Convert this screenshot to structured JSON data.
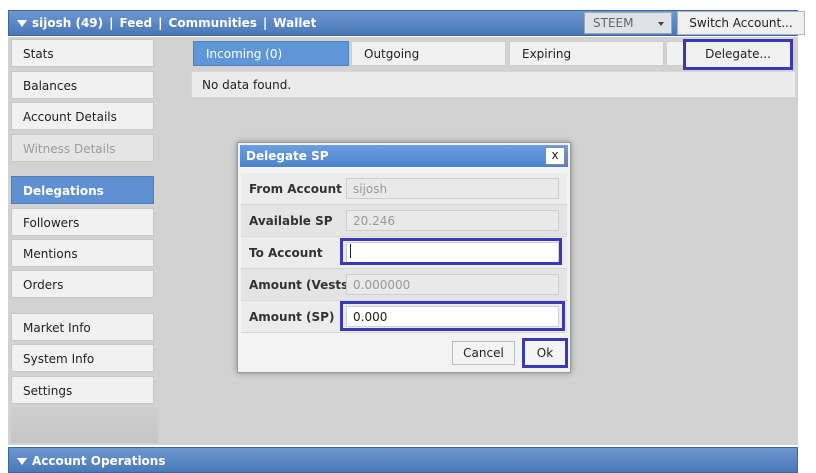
{
  "topbar": {
    "user": "sijosh (49)",
    "separator": "|",
    "links": [
      "Feed",
      "Communities",
      "Wallet"
    ],
    "currency": "STEEM",
    "switch_account_label": "Switch Account..."
  },
  "sidebar": {
    "items": [
      {
        "label": "Stats"
      },
      {
        "label": "Balances"
      },
      {
        "label": "Account Details"
      },
      {
        "label": "Witness Details"
      },
      {
        "label": "Delegations"
      },
      {
        "label": "Followers"
      },
      {
        "label": "Mentions"
      },
      {
        "label": "Orders"
      },
      {
        "label": "Market Info"
      },
      {
        "label": "System Info"
      },
      {
        "label": "Settings"
      }
    ]
  },
  "tabs": [
    {
      "label": "Incoming (0)"
    },
    {
      "label": "Outgoing"
    },
    {
      "label": "Expiring"
    }
  ],
  "delegate_button_label": "Delegate...",
  "no_data_text": "No data found.",
  "bottombar": {
    "label": "Account Operations"
  },
  "dialog": {
    "title": "Delegate SP",
    "close_label": "x",
    "fields": [
      {
        "label": "From Account",
        "value": ""
      },
      {
        "label": "Available SP",
        "value": ""
      },
      {
        "label": "To Account",
        "value": ""
      },
      {
        "label": "Amount (Vests)",
        "value": ""
      },
      {
        "label": "Amount (SP)",
        "value": "0.000"
      }
    ],
    "placeholders": {
      "from_account": "sijosh",
      "available_sp": "20.246",
      "amount_vests": "0.000000"
    },
    "cancel_label": "Cancel",
    "ok_label": "Ok"
  },
  "colors": {
    "accent_blue": "#5f96d8",
    "highlight_border": "#3a3ab8",
    "background_grey": "#d2d2d2"
  }
}
